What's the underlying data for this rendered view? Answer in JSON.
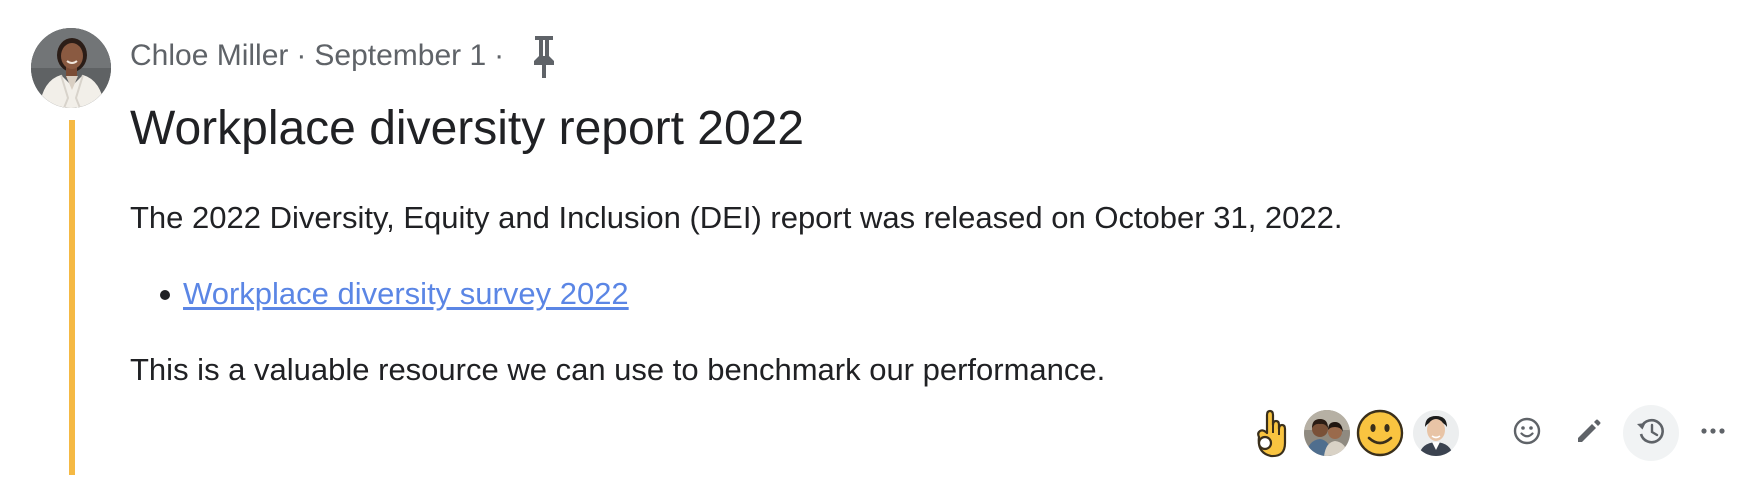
{
  "post": {
    "author": "Chloe Miller",
    "date": "September 1",
    "separator": "·",
    "title": "Workplace diversity report 2022",
    "body_paragraph_1": "The 2022 Diversity, Equity and Inclusion (DEI) report was released on October 31, 2022.",
    "link_text": "Workplace diversity survey 2022",
    "body_paragraph_2": "This is a valuable resource we can use to benchmark our performance.",
    "accent_color": "#f5b944",
    "link_color": "#5b86e5"
  },
  "reactions": [
    {
      "icon": "ok-hand-emoji-icon"
    },
    {
      "icon": "reactor-avatar-couple"
    },
    {
      "icon": "slightly-smiling-face-emoji-icon"
    },
    {
      "icon": "reactor-avatar-man"
    }
  ],
  "actions": [
    {
      "icon": "add-reaction-icon"
    },
    {
      "icon": "edit-icon"
    },
    {
      "icon": "history-icon"
    },
    {
      "icon": "more-icon"
    }
  ]
}
